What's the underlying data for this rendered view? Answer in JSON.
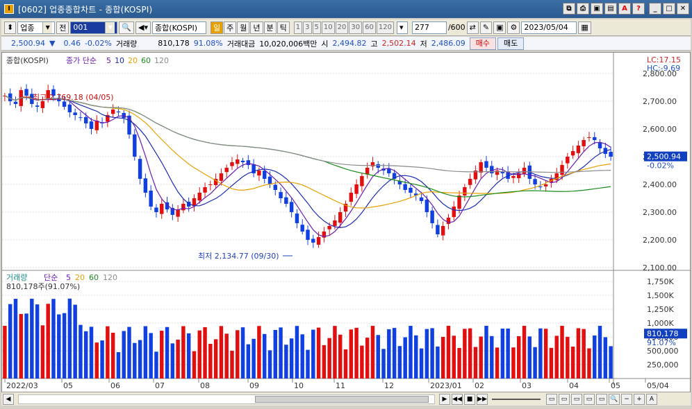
{
  "window": {
    "title": "[0602] 업종종합차트 - 종합(KOSPI)",
    "app_icon": "I"
  },
  "toolbar": {
    "sector_label": "업종",
    "prev_label": "전",
    "code_value": "001",
    "index_name": "종합(KOSPI)",
    "periods": [
      "일",
      "주",
      "월",
      "년",
      "분",
      "틱"
    ],
    "active_period": "일",
    "intervals": [
      "1",
      "3",
      "5",
      "10",
      "20",
      "30",
      "60",
      "120"
    ],
    "count_value": "277",
    "count_total": "/600",
    "date_value": "2023/05/04"
  },
  "quote": {
    "price": "2,500.94",
    "change": "0.46",
    "change_pct": "-0.02%",
    "volume_label": "거래량",
    "volume": "810,178",
    "volume_pct": "91.08%",
    "amount_label": "거래대금",
    "amount": "10,020,006백만",
    "open_label": "시",
    "open": "2,494.82",
    "high_label": "고",
    "high": "2,502.14",
    "low_label": "저",
    "low": "2,486.09",
    "buy_label": "매수",
    "sell_label": "매도"
  },
  "price_panel": {
    "name": "종합(KOSPI)",
    "ma_label": "종가 단순",
    "ma_periods": [
      "5",
      "10",
      "20",
      "60",
      "120"
    ],
    "ma_colors": [
      "#6a1bb0",
      "#1a2ab0",
      "#e8a000",
      "#1a8a1a",
      "#8a8a8a"
    ],
    "lc": "LC:17.15",
    "hc": "HC:-9.69",
    "high_annot": "최고 2,769.18 (04/05)",
    "low_annot": "최저 2,134.77 (09/30)",
    "last_price_box": "2,500.94",
    "last_change": "-0.02%",
    "y_ticks": [
      "2,800.00",
      "2,700.00",
      "2,600.00",
      "2,500.00",
      "2,400.00",
      "2,300.00",
      "2,200.00",
      "2,100.00"
    ]
  },
  "volume_panel": {
    "label": "거래량",
    "ma_label": "단순",
    "ma_periods": [
      "5",
      "20",
      "60",
      "120"
    ],
    "current": "810,178주(91.07%)",
    "last_box": "810,178",
    "last_pct": "91.07%",
    "y_ticks": [
      "1,750K",
      "1,500K",
      "1,250K",
      "1,000K",
      "750,000",
      "500,000",
      "250,000"
    ]
  },
  "x_axis": [
    "2022/03",
    "05",
    "06",
    "07",
    "08",
    "09",
    "10",
    "11",
    "12",
    "2023/01",
    "02",
    "03",
    "04",
    "05",
    "05/04"
  ],
  "chart_data": {
    "type": "candlestick",
    "title": "종합(KOSPI)",
    "ylim": [
      2100,
      2800
    ],
    "closes_approx": [
      2720,
      2700,
      2690,
      2740,
      2720,
      2690,
      2680,
      2700,
      2740,
      2720,
      2700,
      2680,
      2660,
      2650,
      2640,
      2620,
      2600,
      2630,
      2620,
      2650,
      2670,
      2660,
      2640,
      2580,
      2500,
      2420,
      2370,
      2320,
      2300,
      2330,
      2310,
      2290,
      2310,
      2330,
      2320,
      2350,
      2370,
      2390,
      2400,
      2420,
      2440,
      2460,
      2480,
      2490,
      2480,
      2470,
      2440,
      2450,
      2420,
      2400,
      2380,
      2350,
      2330,
      2300,
      2260,
      2230,
      2200,
      2190,
      2210,
      2230,
      2250,
      2270,
      2300,
      2330,
      2370,
      2400,
      2430,
      2460,
      2480,
      2460,
      2450,
      2440,
      2420,
      2400,
      2380,
      2370,
      2360,
      2340,
      2300,
      2260,
      2220,
      2250,
      2280,
      2320,
      2360,
      2390,
      2420,
      2450,
      2480,
      2460,
      2440,
      2450,
      2440,
      2420,
      2430,
      2440,
      2460,
      2420,
      2400,
      2390,
      2400,
      2420,
      2440,
      2470,
      2500,
      2520,
      2540,
      2560,
      2570,
      2560,
      2530,
      2510,
      2500
    ],
    "high": {
      "value": 2769.18,
      "date": "04/05"
    },
    "low": {
      "value": 2134.77,
      "date": "09/30"
    },
    "last": 2500.94,
    "volume_last": 810178
  }
}
